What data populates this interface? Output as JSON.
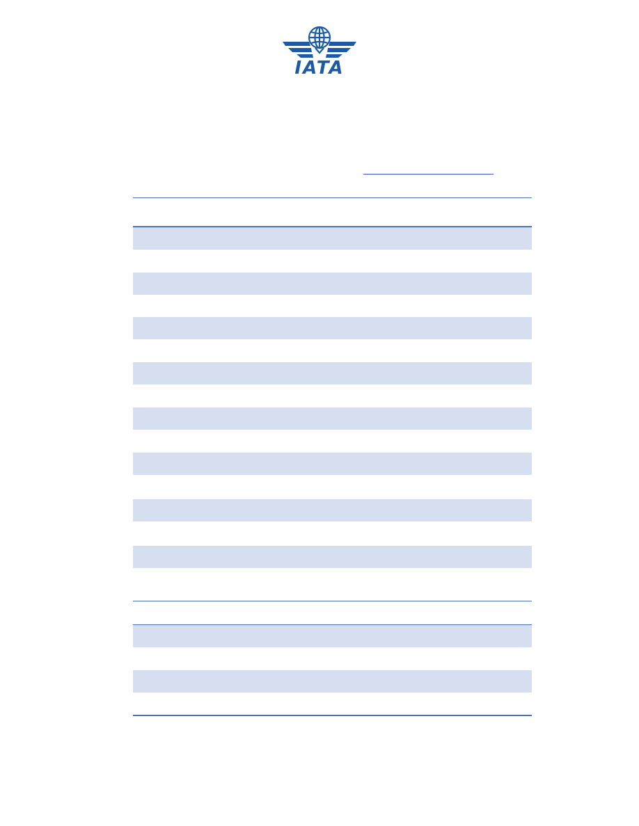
{
  "logo": {
    "wordmark": "IATA",
    "color": "#1b5aa6"
  },
  "colors": {
    "band": "#d5dfef",
    "rule": "#4a6fb5",
    "link": "#3a56c4"
  },
  "table": {
    "section_one_rows": 15,
    "section_two_rows": 4
  }
}
